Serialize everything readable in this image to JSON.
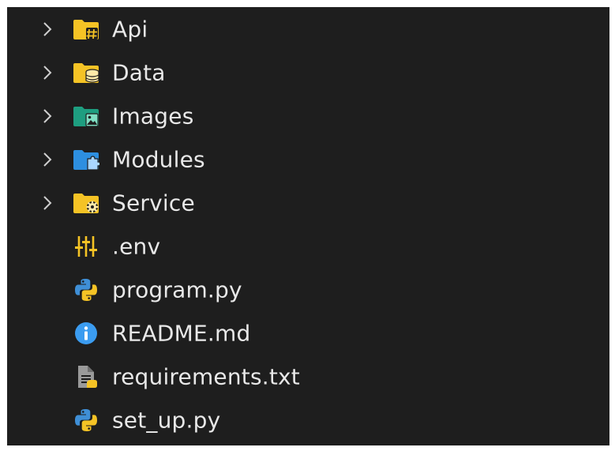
{
  "explorer": {
    "items": [
      {
        "label": "Api",
        "type": "folder",
        "icon": "folder-api-icon",
        "color": "#f5c325"
      },
      {
        "label": "Data",
        "type": "folder",
        "icon": "folder-database-icon",
        "color": "#f5c325"
      },
      {
        "label": "Images",
        "type": "folder",
        "icon": "folder-images-icon",
        "color": "#1e9e80"
      },
      {
        "label": "Modules",
        "type": "folder",
        "icon": "folder-modules-icon",
        "color": "#2d8fe0"
      },
      {
        "label": "Service",
        "type": "folder",
        "icon": "folder-service-icon",
        "color": "#f5c325"
      },
      {
        "label": ".env",
        "type": "file",
        "icon": "env-settings-icon",
        "color": "#f5c325"
      },
      {
        "label": "program.py",
        "type": "file",
        "icon": "python-icon",
        "color": "#3f8fd6"
      },
      {
        "label": "README.md",
        "type": "file",
        "icon": "info-icon",
        "color": "#3b9cf0"
      },
      {
        "label": "requirements.txt",
        "type": "file",
        "icon": "text-file-icon",
        "color": "#9a9a9a"
      },
      {
        "label": "set_up.py",
        "type": "file",
        "icon": "python-icon",
        "color": "#3f8fd6"
      }
    ]
  }
}
